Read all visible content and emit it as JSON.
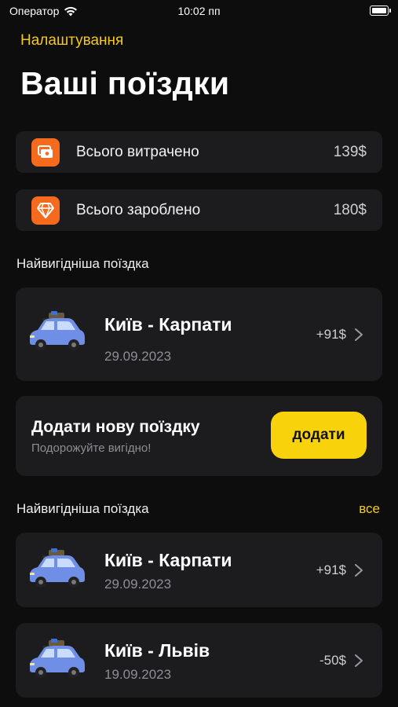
{
  "status_bar": {
    "carrier": "Оператор",
    "time": "10:02 пп"
  },
  "header": {
    "back_label": "Налаштування",
    "title": "Ваші поїздки"
  },
  "summary": [
    {
      "label": "Всього витрачено",
      "value": "139$",
      "icon": "wallet-icon"
    },
    {
      "label": "Всього зароблено",
      "value": "180$",
      "icon": "diamond-icon"
    }
  ],
  "best_trip": {
    "section_title": "Найвигідніша поїздка",
    "trip": {
      "name": "Київ - Карпати",
      "date": "29.09.2023",
      "amount": "+91$"
    }
  },
  "add_trip": {
    "title": "Додати нову поїздку",
    "subtitle": "Подорожуйте вигідно!",
    "button_label": "додати"
  },
  "trips_list": {
    "section_title": "Найвигідніша поїздка",
    "see_all_label": "все",
    "items": [
      {
        "name": "Київ - Карпати",
        "date": "29.09.2023",
        "amount": "+91$"
      },
      {
        "name": "Київ - Львів",
        "date": "19.09.2023",
        "amount": "-50$"
      }
    ]
  },
  "colors": {
    "accent": "#f8d20b",
    "icon_bg": "#f56a1d",
    "card_bg": "#1c1c1e",
    "background": "#0d0d0d"
  }
}
